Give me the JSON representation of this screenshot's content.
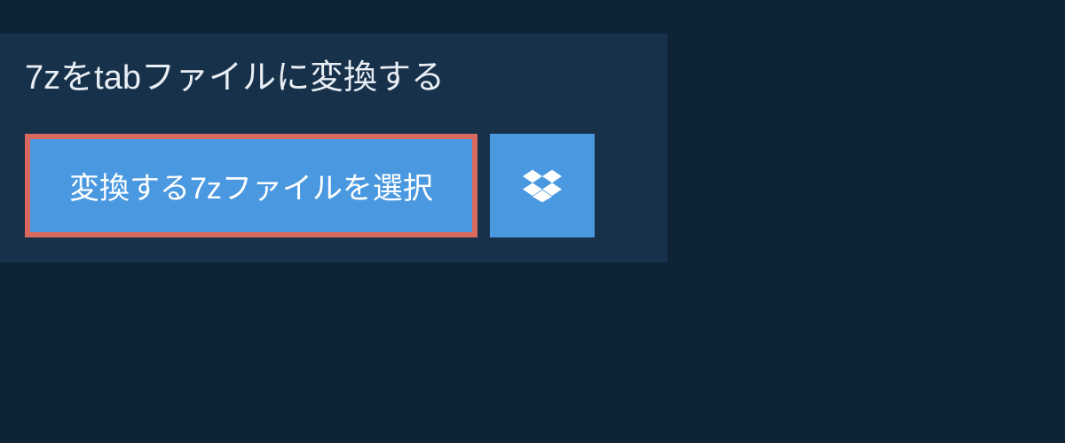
{
  "header": {
    "title": "7zをtabファイルに変換する"
  },
  "actions": {
    "select_file_label": "変換する7zファイルを選択",
    "dropbox_label": "Dropbox"
  }
}
